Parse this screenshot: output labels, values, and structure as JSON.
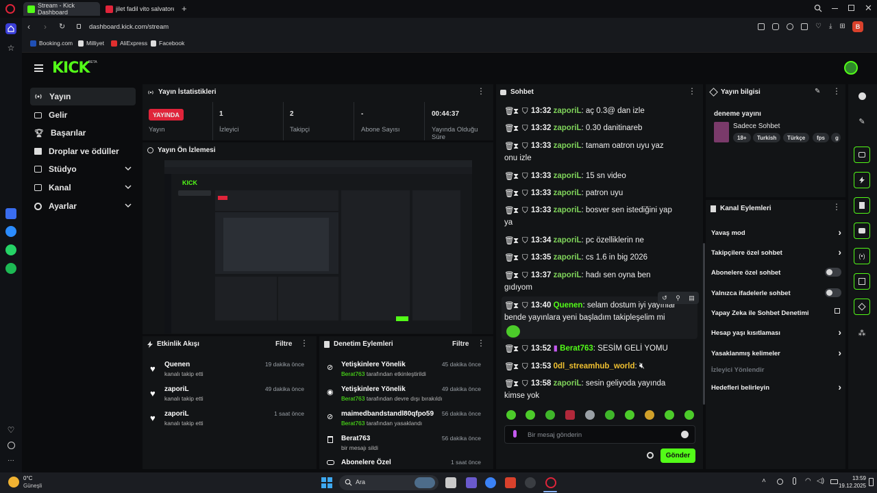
{
  "browser": {
    "tabs": [
      {
        "label": "Stream - Kick Dashboard"
      },
      {
        "label": "jilet fadil vito salvatore - Y"
      }
    ],
    "url": "dashboard.kick.com/stream",
    "bookmarks": [
      {
        "label": "Booking.com"
      },
      {
        "label": "Milliyet"
      },
      {
        "label": "AliExpress"
      },
      {
        "label": "Facebook"
      }
    ],
    "profile_initial": "B"
  },
  "kick": {
    "logo": "KICK",
    "logo_badge": "BETA",
    "nav": [
      {
        "label": "Yayın",
        "icon": "broadcast-icon"
      },
      {
        "label": "Gelir",
        "icon": "wallet-icon"
      },
      {
        "label": "Başarılar",
        "icon": "trophy-icon"
      },
      {
        "label": "Droplar ve ödüller",
        "icon": "gift-icon"
      },
      {
        "label": "Stüdyo",
        "icon": "studio-icon"
      },
      {
        "label": "Kanal",
        "icon": "channel-icon"
      },
      {
        "label": "Ayarlar",
        "icon": "settings-icon"
      }
    ]
  },
  "stats": {
    "title": "Yayın İstatistikleri",
    "live_badge": "YAYINDA",
    "items": [
      {
        "value": "",
        "label": "Yayın"
      },
      {
        "value": "1",
        "label": "İzleyici"
      },
      {
        "value": "2",
        "label": "Takipçi"
      },
      {
        "value": "-",
        "label": "Abone Sayısı"
      },
      {
        "value": "00:44:37",
        "label": "Yayında Olduğu",
        "label2": "Süre"
      }
    ]
  },
  "preview": {
    "title": "Yayın Ön İzlemesi"
  },
  "activity": {
    "title": "Etkinlik Akışı",
    "filter": "Filtre",
    "items": [
      {
        "user": "Quenen",
        "text": "kanalı takip etti",
        "time": "19 dakika önce"
      },
      {
        "user": "zaporiL",
        "text": "kanalı takip etti",
        "time": "49 dakika önce"
      },
      {
        "user": "zaporiL",
        "text": "kanalı takip etti",
        "time": "1 saat önce"
      }
    ]
  },
  "moderation": {
    "title": "Denetim Eylemleri",
    "filter": "Filtre",
    "items": [
      {
        "title": "Yetişkinlere Yönelik",
        "user": "Berat763",
        "text": "tarafından etkinleştirildi",
        "time": "45 dakika önce"
      },
      {
        "title": "Yetişkinlere Yönelik",
        "user": "Berat763",
        "text": "tarafından devre dışı bırakıldı",
        "time": "49 dakika önce"
      },
      {
        "title": "maimedbandstandl80qfpo59",
        "user": "Berat763",
        "text": "tarafından yasaklandı",
        "time": "56 dakika önce"
      },
      {
        "title": "Berat763",
        "user": "",
        "text": "bir mesajı sildi",
        "time": "56 dakika önce"
      },
      {
        "title": "Abonelere Özel",
        "user": "",
        "text": "",
        "time": "1 saat önce"
      }
    ]
  },
  "chat": {
    "title": "Sohbet",
    "messages": [
      {
        "time": "13:32",
        "user": "zaporiL",
        "text": "aç 0.3@ dan izle"
      },
      {
        "time": "13:32",
        "user": "zaporiL",
        "text": "0.30 danitinareb"
      },
      {
        "time": "13:33",
        "user": "zaporiL",
        "text": "tamam oatron uyu yaz",
        "text2": "onu izle"
      },
      {
        "time": "13:33",
        "user": "zaporiL",
        "text": "15 sn video"
      },
      {
        "time": "13:33",
        "user": "zaporiL",
        "text": "patron uyu"
      },
      {
        "time": "13:33",
        "user": "zaporiL",
        "text": "bosver sen istediğini yap",
        "text2": "ya"
      },
      {
        "time": "13:34",
        "user": "zaporiL",
        "text": "pc özelliklerin ne"
      },
      {
        "time": "13:35",
        "user": "zaporiL",
        "text": "cs 1.6 in big 2026"
      },
      {
        "time": "13:37",
        "user": "zaporiL",
        "text": "hadı sen oyna ben",
        "text2": "gıdıyom"
      },
      {
        "time": "13:40",
        "user": "Quenen",
        "text": "selam dostum iyi yayınlar",
        "text2": "bende yayınlara yeni başladım takipleşelim mi"
      },
      {
        "time": "13:52",
        "user": "Berat763",
        "text": "SESİM GELİ YOMU"
      },
      {
        "time": "13:53",
        "user": "0dl_streamhub_world",
        "text": ""
      },
      {
        "time": "13:58",
        "user": "zaporiL",
        "text": "sesin geliyoda yayında",
        "text2": "kimse yok"
      }
    ],
    "input_placeholder": "Bir mesaj gönderin",
    "send_label": "Gönder"
  },
  "stream_info": {
    "title": "Yayın bilgisi",
    "stream_title": "deneme yayını",
    "category": "Sadece Sohbet",
    "tags": [
      "18+",
      "Turkish",
      "Türkçe",
      "fps",
      "g"
    ]
  },
  "channel_actions": {
    "title": "Kanal Eylemleri",
    "items": [
      {
        "label": "Yavaş mod",
        "control": "chevron"
      },
      {
        "label": "Takipçilere özel sohbet",
        "control": "chevron"
      },
      {
        "label": "Abonelere özel sohbet",
        "control": "toggle"
      },
      {
        "label": "Yalnızca ifadelerle sohbet",
        "control": "toggle"
      },
      {
        "label": "Yapay Zeka ile Sohbet Denetimi",
        "control": "external"
      },
      {
        "label": "Hesap yaşı kısıtlaması",
        "control": "chevron"
      },
      {
        "label": "Yasaklanmış kelimeler",
        "control": "chevron"
      },
      {
        "label": "İzleyici Yönlendir",
        "control": "none"
      },
      {
        "label": "Hedefleri belirleyin",
        "control": "chevron"
      }
    ]
  },
  "taskbar": {
    "weather_temp": "0°C",
    "weather_text": "Güneşli",
    "search_label": "Ara",
    "time": "13:59",
    "date": "19.12.2025"
  },
  "colors": {
    "accent": "#53fc18",
    "live": "#e0243a",
    "panel": "#121416"
  }
}
